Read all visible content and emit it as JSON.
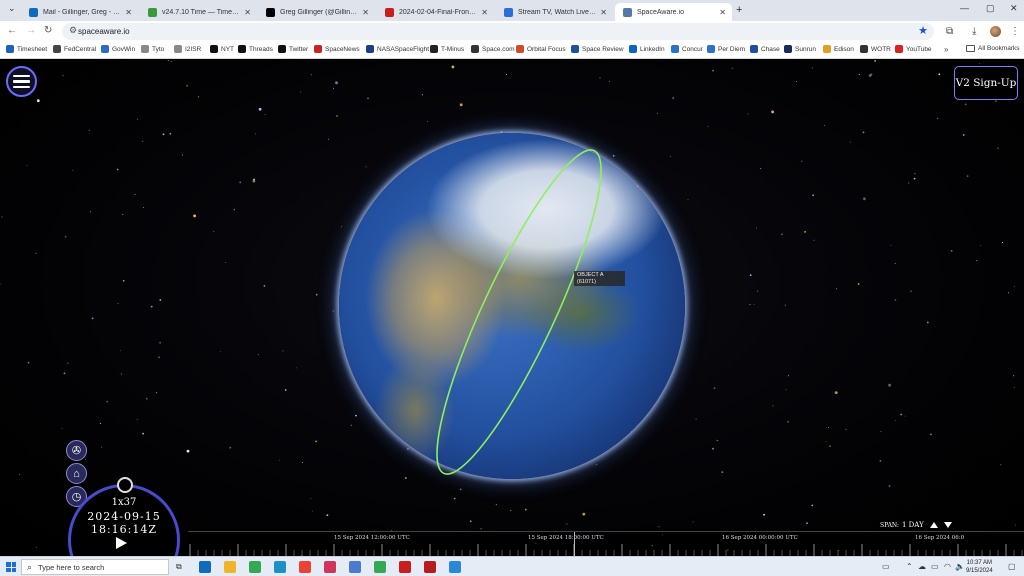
{
  "browser": {
    "tabs": [
      {
        "title": "Mail - Gillinger, Greg - Outlook",
        "icon": "outlook-icon",
        "color": "#0f6cbd",
        "active": false
      },
      {
        "title": "v24.7.10 Time — Timesheet fo",
        "icon": "timesheet-icon",
        "color": "#3a9a3a",
        "active": false
      },
      {
        "title": "Greg Gillinger (@GillingerGreg",
        "icon": "x-icon",
        "color": "#000000",
        "active": false
      },
      {
        "title": "2024-02-04-Final-Frontier-Flag",
        "icon": "pdf-icon",
        "color": "#c81e1e",
        "active": false
      },
      {
        "title": "Stream TV, Watch Live Televisio",
        "icon": "tv-icon",
        "color": "#2b6fd6",
        "active": false
      },
      {
        "title": "SpaceAware.io",
        "icon": "globe-icon",
        "color": "#5577aa",
        "active": true
      }
    ],
    "url": "spaceaware.io",
    "bookmarks": [
      {
        "label": "Timesheet",
        "color": "#1f5fbf"
      },
      {
        "label": "FedCentral",
        "color": "#444444"
      },
      {
        "label": "GovWin",
        "color": "#2d6bc9"
      },
      {
        "label": "Tyto",
        "color": "#888888"
      },
      {
        "label": "I2ISR",
        "color": "#888888"
      },
      {
        "label": "NYT",
        "color": "#111111"
      },
      {
        "label": "Threads",
        "color": "#111111"
      },
      {
        "label": "Twitter",
        "color": "#111111"
      },
      {
        "label": "SpaceNews",
        "color": "#cc2222"
      },
      {
        "label": "NASASpaceFlight",
        "color": "#1b3f8f"
      },
      {
        "label": "T-Minus",
        "color": "#222222"
      },
      {
        "label": "Space.com",
        "color": "#333333"
      },
      {
        "label": "Orbital Focus",
        "color": "#d24a2a"
      },
      {
        "label": "Space Review",
        "color": "#1f4f9f"
      },
      {
        "label": "LinkedIn",
        "color": "#0a66c2"
      },
      {
        "label": "Concur",
        "color": "#2a73c9"
      },
      {
        "label": "Per Diem",
        "color": "#2a73c9"
      },
      {
        "label": "Chase",
        "color": "#1f4fa0"
      },
      {
        "label": "Sunrun",
        "color": "#1a2a5a"
      },
      {
        "label": "Edison",
        "color": "#e0a020"
      },
      {
        "label": "WOTR",
        "color": "#333333"
      },
      {
        "label": "YouTube",
        "color": "#e02020"
      }
    ],
    "all_bookmarks_label": "All Bookmarks",
    "more_label": "»"
  },
  "app": {
    "signup_label": "V2 Sign-Up",
    "object_label": {
      "name": "OBJECT A",
      "id": "(61071)"
    },
    "clock": {
      "speed": "1x37",
      "date": "2024-09-15",
      "time": "18:16:14Z"
    },
    "span": {
      "label": "SPAN:",
      "value": "1 DAY"
    },
    "timeline_labels": [
      "15 Sep 2024 12:00:00 UTC",
      "15 Sep 2024 18:00:00 UTC",
      "16 Sep 2024 00:00:00 UTC",
      "16 Sep 2024 06:0"
    ],
    "side_buttons": [
      "satellite-icon",
      "home-icon",
      "clock-icon"
    ]
  },
  "taskbar": {
    "search_placeholder": "Type here to search",
    "apps": [
      {
        "name": "outlook-app",
        "color": "#0f6cbd"
      },
      {
        "name": "file-explorer-app",
        "color": "#f0b429"
      },
      {
        "name": "chrome-app-1",
        "color": "#34a853"
      },
      {
        "name": "edge-app",
        "color": "#1e90c8"
      },
      {
        "name": "chrome-app-2",
        "color": "#ea4335"
      },
      {
        "name": "paint-app",
        "color": "#d0345a"
      },
      {
        "name": "notepad-app",
        "color": "#4a7bd0"
      },
      {
        "name": "chrome-app-3",
        "color": "#34a853"
      },
      {
        "name": "acrobat-app",
        "color": "#c81e1e"
      },
      {
        "name": "pdf-app",
        "color": "#b71c1c"
      },
      {
        "name": "windows-app",
        "color": "#2b88d8"
      }
    ],
    "time": "10:37 AM",
    "date": "9/15/2024"
  }
}
